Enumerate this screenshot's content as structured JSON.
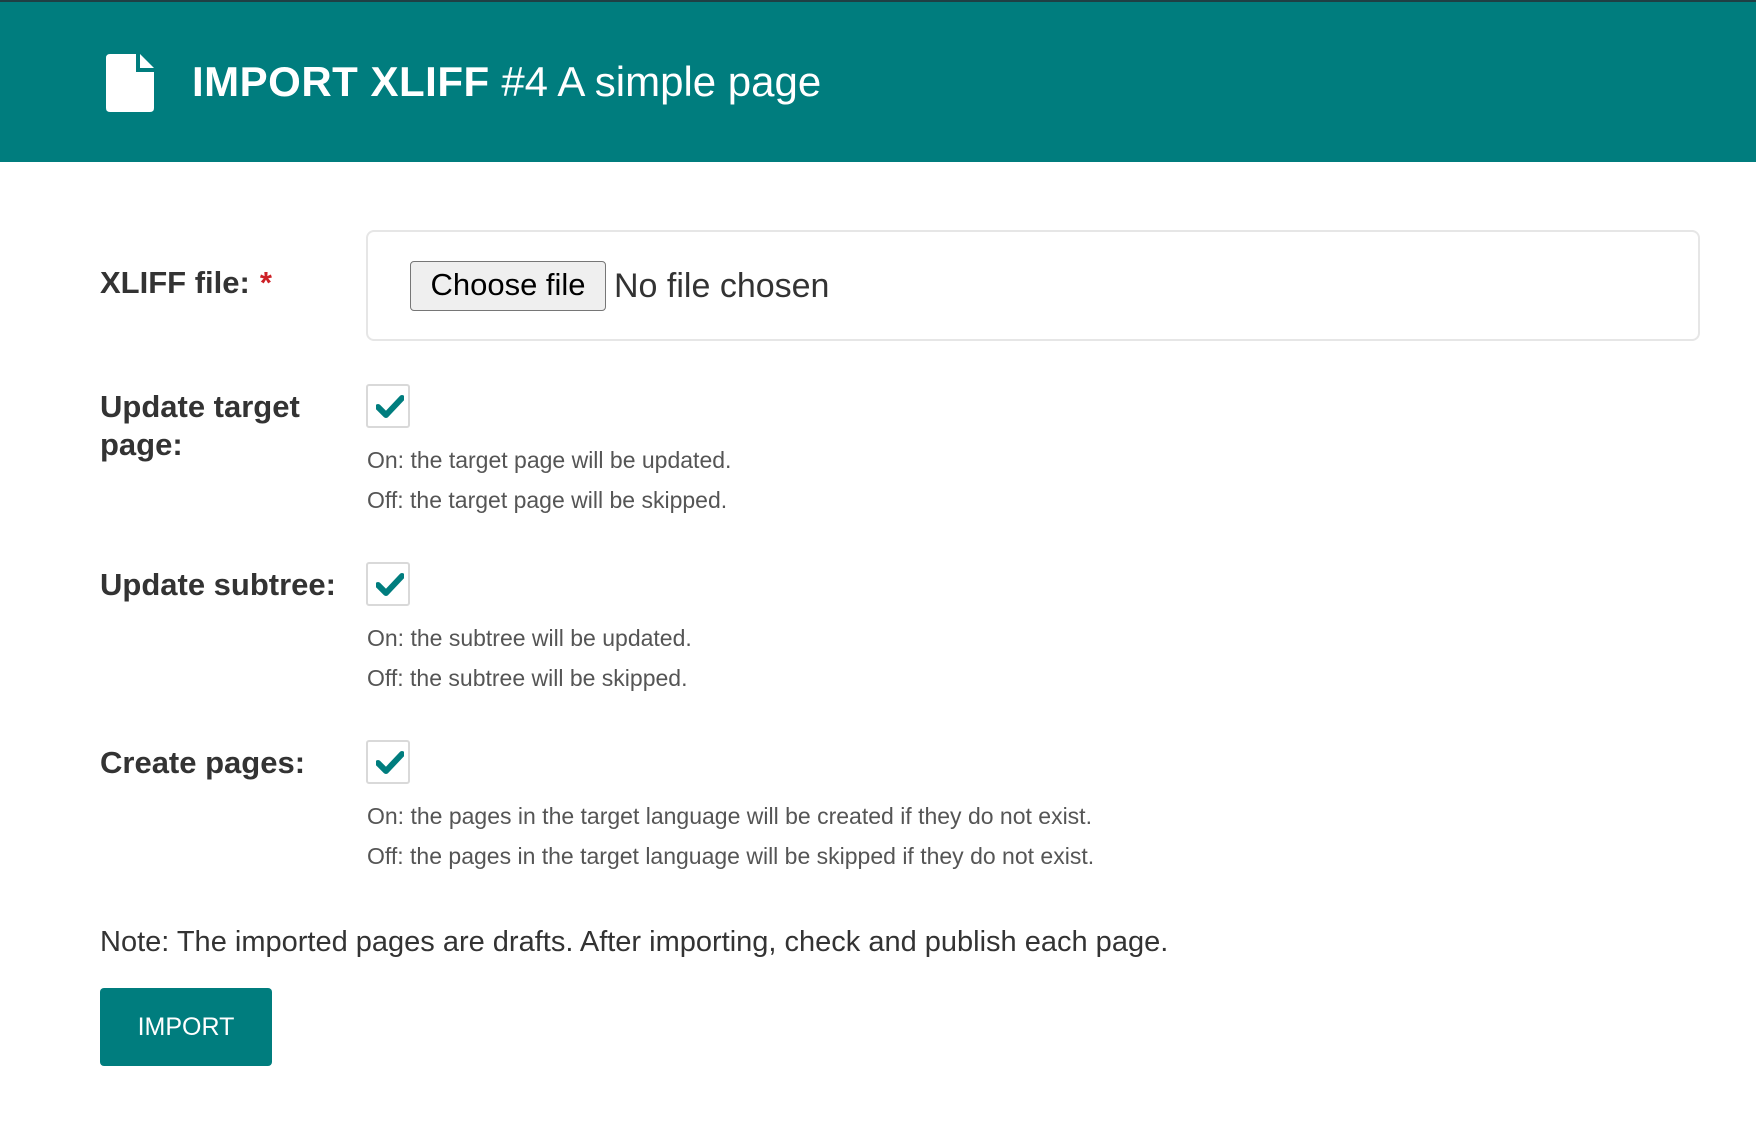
{
  "header": {
    "icon": "document-icon",
    "title_strong": "IMPORT XLIFF",
    "title_sub": "#4 A simple page",
    "background_color": "#007d7e"
  },
  "form": {
    "xliff_file": {
      "label": "XLIFF file:",
      "required_marker": "*",
      "choose_button_label": "Choose file",
      "status_text": "No file chosen"
    },
    "update_target_page": {
      "label_line1": "Update target",
      "label_line2": "page:",
      "checked": true,
      "help_on": "On: the target page will be updated.",
      "help_off": "Off: the target page will be skipped."
    },
    "update_subtree": {
      "label": "Update subtree:",
      "checked": true,
      "help_on": "On: the subtree will be updated.",
      "help_off": "Off: the subtree will be skipped."
    },
    "create_pages": {
      "label": "Create pages:",
      "checked": true,
      "help_on": "On: the pages in the target language will be created if they do not exist.",
      "help_off": "Off: the pages in the target language will be skipped if they do not exist."
    }
  },
  "note": "Note: The imported pages are drafts. After importing, check and publish each page.",
  "import_button_label": "IMPORT",
  "colors": {
    "accent": "#007d7e",
    "required": "#cd2026"
  }
}
